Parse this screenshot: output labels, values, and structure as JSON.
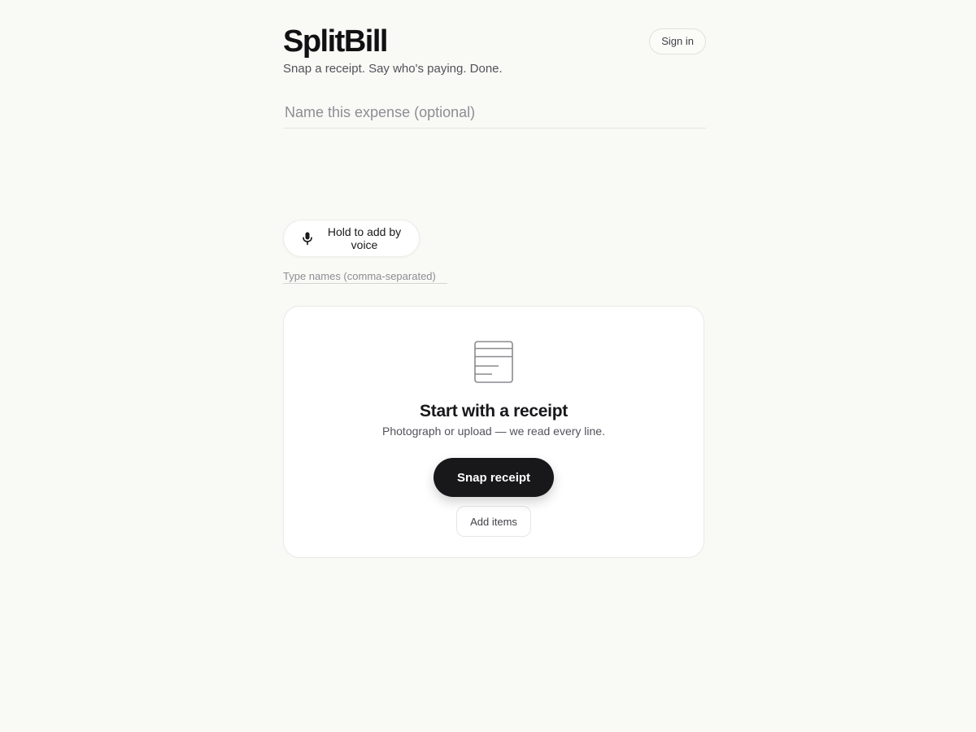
{
  "header": {
    "title": "SplitBill",
    "tagline": "Snap a receipt. Say who's paying. Done.",
    "signin_label": "Sign in"
  },
  "expense": {
    "name_placeholder": "Name this expense (optional)",
    "name_value": ""
  },
  "people": {
    "voice_label": "Hold to add by voice",
    "voice_icon": "microphone-icon",
    "names_placeholder": "Type names (comma-separated)",
    "names_value": ""
  },
  "receipt_card": {
    "icon": "receipt-icon",
    "heading": "Start with a receipt",
    "subtext": "Photograph or upload — we read every line.",
    "snap_label": "Snap receipt",
    "add_items_label": "Add items"
  },
  "colors": {
    "background": "#f9f9f5",
    "primary_button": "#18181b",
    "card": "#ffffff"
  }
}
